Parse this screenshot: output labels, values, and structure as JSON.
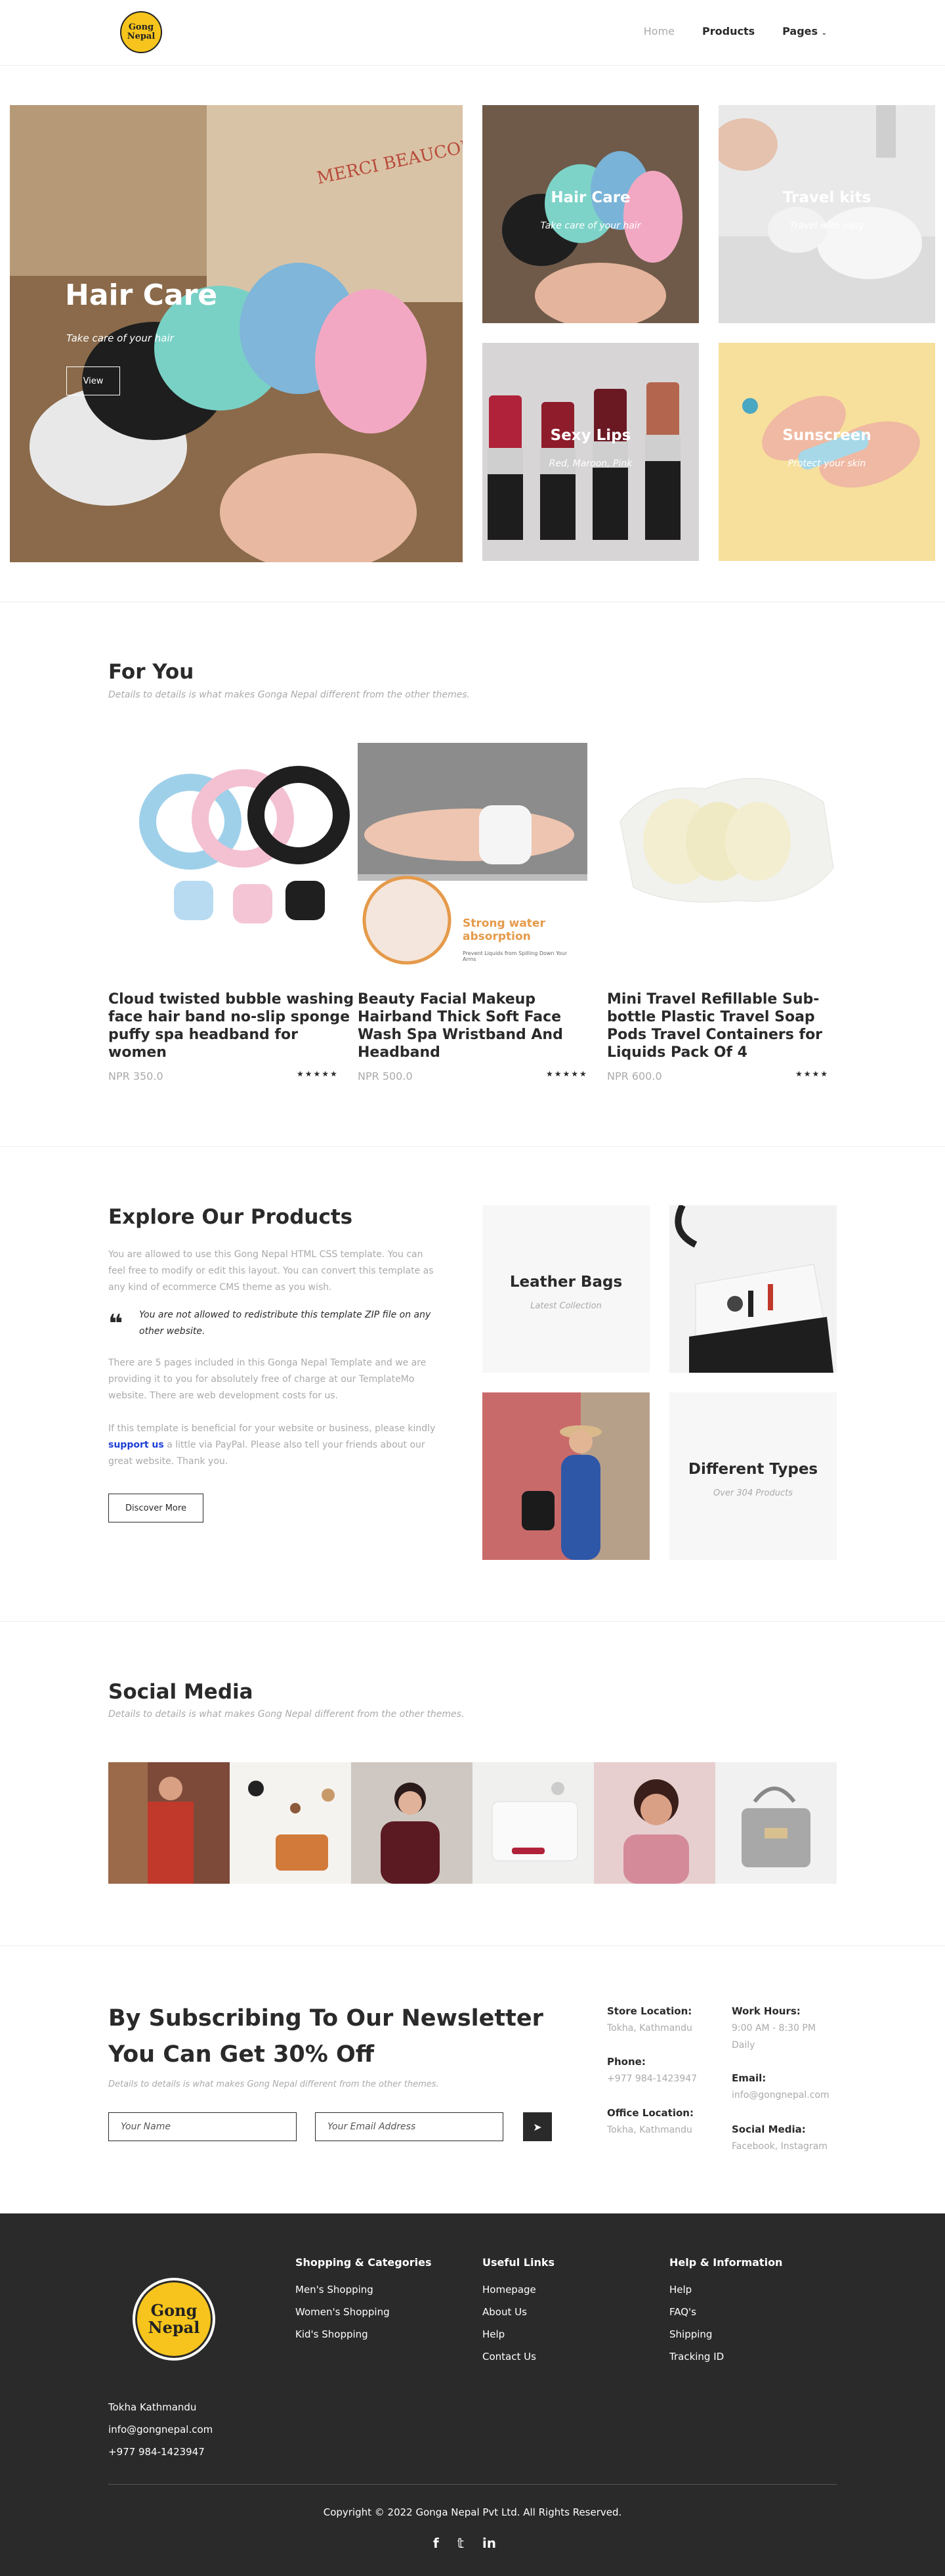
{
  "header": {
    "logo_text": "Gong Nepal",
    "nav": [
      {
        "label": "Home",
        "active": true
      },
      {
        "label": "Products",
        "active": false
      },
      {
        "label": "Pages",
        "active": false
      }
    ]
  },
  "hero": {
    "main": {
      "title": "Hair Care",
      "subtitle": "Take care of your hair",
      "button": "View"
    },
    "tiles": [
      {
        "title": "Hair Care",
        "subtitle": "Take care of your hair"
      },
      {
        "title": "Travel kits",
        "subtitle": "Travel with easy"
      },
      {
        "title": "Sexy Lips",
        "subtitle": "Red, Maroon, Pink"
      },
      {
        "title": "Sunscreen",
        "subtitle": "Protect your skin"
      }
    ]
  },
  "for_you": {
    "title": "For You",
    "subtitle": "Details to details is what makes Gonga Nepal different from the other themes.",
    "products": [
      {
        "title": "Cloud twisted bubble washing face hair band no-slip sponge puffy spa headband for women",
        "price": "NPR 350.0",
        "stars": "★★★★★"
      },
      {
        "title": "Beauty Facial Makeup Hairband Thick Soft Face Wash Spa Wristband And Headband",
        "price": "NPR 500.0",
        "stars": "★★★★★",
        "img_caption": "Strong water absorption",
        "img_small": "Prevent Liquids from Spilling Down Your Arms"
      },
      {
        "title": "Mini Travel Refillable Sub-bottle Plastic Travel Soap Pods Travel Containers for Liquids Pack Of 4",
        "price": "NPR 600.0",
        "stars": "★★★★"
      }
    ]
  },
  "explore": {
    "title": "Explore Our Products",
    "p1": "You are allowed to use this Gong Nepal HTML CSS template. You can feel free to modify or edit this layout. You can convert this template as any kind of ecommerce CMS theme as you wish.",
    "quote": "You are not allowed to redistribute this template ZIP file on any other website.",
    "p2": "There are 5 pages included in this Gonga Nepal Template and we are providing it to you for absolutely free of charge at our TemplateMo website. There are web development costs for us.",
    "p3_a": "If this template is beneficial for your website or business, please kindly",
    "p3_link": "support us",
    "p3_b": "a little via PayPal. Please also tell your friends about our great website. Thank you.",
    "button": "Discover More",
    "boxes": [
      {
        "title": "Leather Bags",
        "subtitle": "Latest Collection"
      },
      {
        "title": "Different Types",
        "subtitle": "Over 304 Products"
      }
    ]
  },
  "social": {
    "title": "Social Media",
    "subtitle": "Details to details is what makes Gong Nepal different from the other themes."
  },
  "newsletter": {
    "title": "By Subscribing To Our Newsletter You Can Get 30% Off",
    "subtitle": "Details to details is what makes Gong Nepal different from the other themes.",
    "name_placeholder": "Your Name",
    "email_placeholder": "Your Email Address",
    "info": {
      "store_label": "Store Location:",
      "store_value": "Tokha, Kathmandu",
      "phone_label": "Phone:",
      "phone_value": "+977 984-1423947",
      "office_label": "Office Location:",
      "office_value": "Tokha, Kathmandu",
      "hours_label": "Work Hours:",
      "hours_value": "9:00 AM - 8:30 PM Daily",
      "email_label": "Email:",
      "email_value": "info@gongnepal.com",
      "social_label": "Social Media:",
      "social_value": "Facebook, Instagram"
    }
  },
  "footer": {
    "logo_text": "Gong Nepal",
    "address": "Tokha Kathmandu",
    "email": "info@gongnepal.com",
    "phone": "+977 984-1423947",
    "col1": {
      "title": "Shopping & Categories",
      "links": [
        "Men's Shopping",
        "Women's Shopping",
        "Kid's Shopping"
      ]
    },
    "col2": {
      "title": "Useful Links",
      "links": [
        "Homepage",
        "About Us",
        "Help",
        "Contact Us"
      ]
    },
    "col3": {
      "title": "Help & Information",
      "links": [
        "Help",
        "FAQ's",
        "Shipping",
        "Tracking ID"
      ]
    },
    "copyright": "Copyright © 2022 Gonga Nepal Pvt Ltd. All Rights Reserved.",
    "social_icons": [
      "facebook-icon",
      "twitter-icon",
      "linkedin-icon"
    ]
  }
}
